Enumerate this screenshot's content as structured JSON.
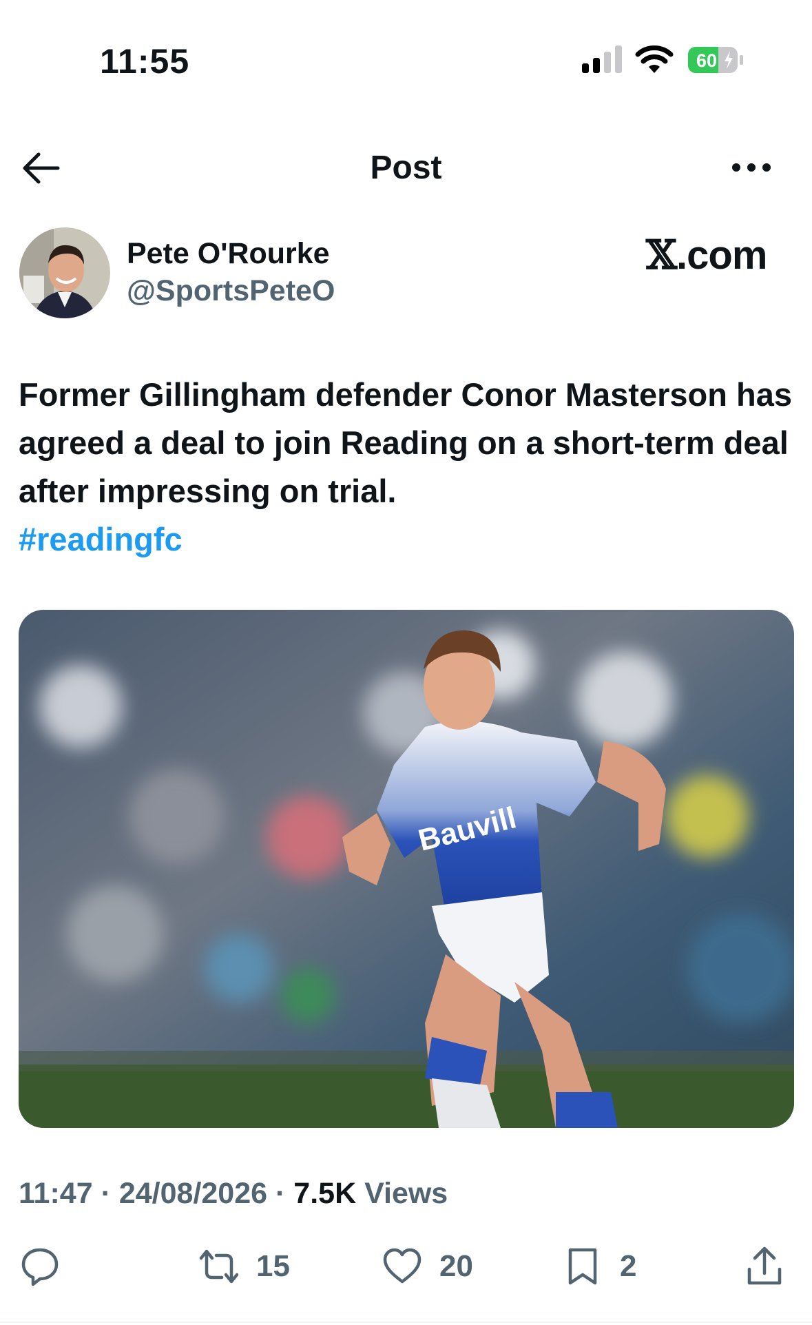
{
  "status_bar": {
    "time": "11:55",
    "battery": "60",
    "icons": [
      "cellular-signal-icon",
      "wifi-icon",
      "battery-charging-icon"
    ]
  },
  "nav": {
    "title": "Post",
    "back_icon": "arrow-left-icon",
    "more_icon": "more-horizontal-icon"
  },
  "author": {
    "name": "Pete O'Rourke",
    "handle": "@SportsPeteO"
  },
  "brand": {
    "x": "𝕏",
    "suffix": ".com"
  },
  "post": {
    "text": "Former Gillingham defender Conor Masterson has agreed a deal to join Reading on a short-term deal after impressing on trial.",
    "hashtag": "#readingfc"
  },
  "meta": {
    "time": "11:47",
    "separator": "·",
    "date": "24/08/2026",
    "views_count": "7.5K",
    "views_label": "Views"
  },
  "actions": {
    "reply": {
      "icon": "reply-icon",
      "count": ""
    },
    "repost": {
      "icon": "repost-icon",
      "count": "15"
    },
    "like": {
      "icon": "heart-icon",
      "count": "20"
    },
    "bookmark": {
      "icon": "bookmark-icon",
      "count": "2"
    },
    "share": {
      "icon": "share-icon"
    }
  },
  "colors": {
    "text": "#0f1419",
    "secondary": "#536471",
    "link": "#1d9bf0",
    "battery_fill": "#34c759"
  }
}
